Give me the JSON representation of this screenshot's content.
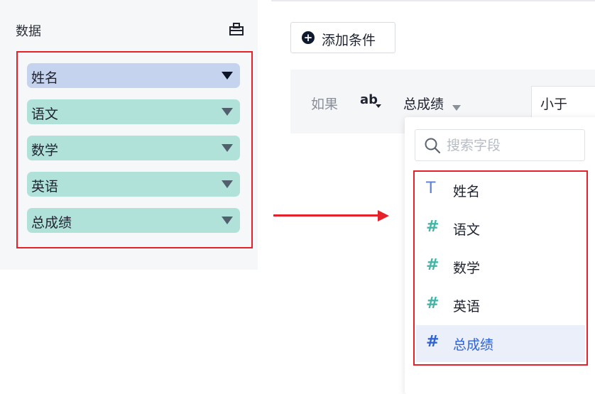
{
  "data_panel": {
    "title": "数据",
    "tool_icon": "toolbox-icon",
    "fields": [
      {
        "label": "姓名",
        "kind": "dimension"
      },
      {
        "label": "语文",
        "kind": "measure"
      },
      {
        "label": "数学",
        "kind": "measure"
      },
      {
        "label": "英语",
        "kind": "measure"
      },
      {
        "label": "总成绩",
        "kind": "measure"
      }
    ]
  },
  "filter": {
    "add_button_label": "添加条件",
    "if_label": "如果",
    "ab_label": "ab",
    "field_selected": "总成绩",
    "operator": "小于"
  },
  "dropdown": {
    "search_placeholder": "搜索字段",
    "items": [
      {
        "type_icon": "T",
        "label": "姓名"
      },
      {
        "type_icon": "#",
        "label": "语文"
      },
      {
        "type_icon": "#",
        "label": "数学"
      },
      {
        "type_icon": "#",
        "label": "英语"
      },
      {
        "type_icon": "#",
        "label": "总成绩"
      }
    ],
    "selected": "总成绩"
  },
  "colors": {
    "highlight_red": "#e5222a",
    "dimension_pill": "#c5d3ee",
    "measure_pill": "#b0e2da",
    "selected_text": "#3163d4"
  }
}
